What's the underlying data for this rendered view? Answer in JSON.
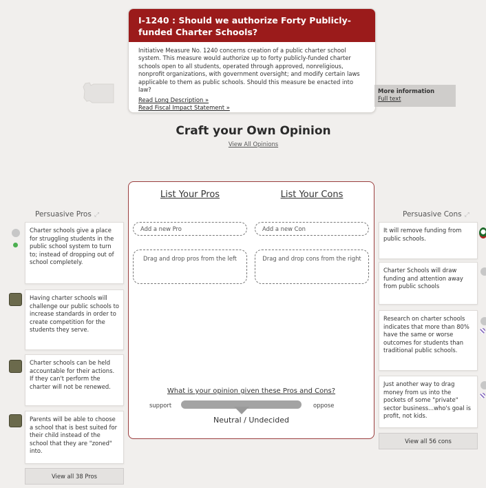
{
  "measure": {
    "id": "I-1240",
    "separator": " : ",
    "question": "Should we authorize Forty Publicly-funded Charter Schools?",
    "description": "Initiative Measure No. 1240 concerns creation of a public charter school system. This measure would authorize up to forty publicly-funded charter schools open to all students, operated through approved, nonreligious, nonprofit organizations, with government oversight; and modify certain laws applicable to them as public schools. Should this measure be enacted into law?",
    "long_desc_link": "Read Long Description »",
    "fiscal_link": "Read Fiscal Impact Statement »"
  },
  "more_info": {
    "title": "More information",
    "link": "Full text"
  },
  "craft": {
    "title": "Craft your Own Opinion",
    "view_all": "View All Opinions"
  },
  "opinion": {
    "pros_heading": "List Your Pros",
    "cons_heading": "List Your Cons",
    "add_pro_placeholder": "Add a new Pro",
    "add_con_placeholder": "Add a new Con",
    "drag_pros": "Drag and drop pros from the left",
    "drag_cons": "Drag and drop cons from the right",
    "question": "What is your opinion given these Pros and Cons?",
    "support_label": "support",
    "oppose_label": "oppose",
    "status": "Neutral / Undecided",
    "slider_value": 0.5
  },
  "pros": {
    "title": "Persuasive Pros",
    "items": [
      "Charter schools give a place for struggling students in the public school system to turn to; instead of dropping out of school completely.",
      "Having charter schools will challenge our public schools to increase standards in order to create competition for the students they serve.",
      "Charter schools can be held accountable for their actions. If they can't perform the charter will not be renewed.",
      "Parents will be able to choose a school that is best suited for their child instead of the school that they are \"zoned\" into."
    ],
    "view_all": "View all 38 Pros"
  },
  "cons": {
    "title": "Persuasive Cons",
    "items": [
      "It will remove funding from public schools.",
      "Charter Schools will draw funding and attention away from public schools",
      "Research on charter schools indicates that more than 80% have the same or worse outcomes for students than traditional public schools.",
      "Just another way to drag money from us into the pockets of some \"private\" sector business...who's goal is profit, not kids."
    ],
    "view_all": "View all 56 cons"
  }
}
